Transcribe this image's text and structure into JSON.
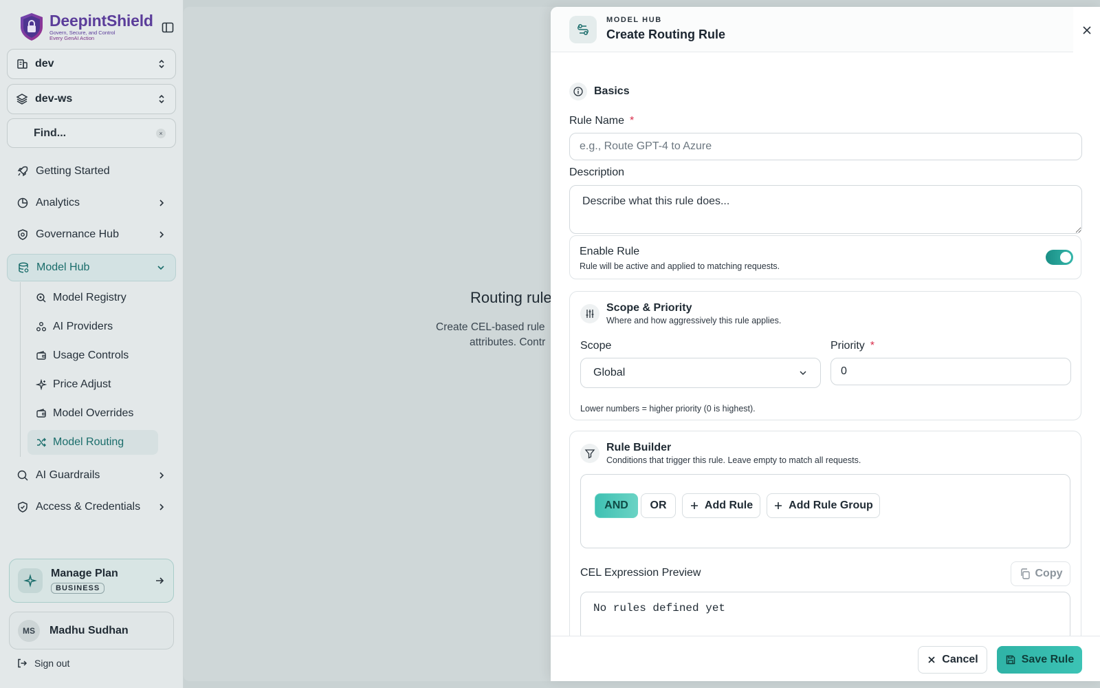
{
  "brand": {
    "name": "DeepintShield",
    "tagline_1": "Govern, Secure, and Control",
    "tagline_2": "Every GenAI Action"
  },
  "sidebar": {
    "org_selector": "dev",
    "workspace_selector": "dev-ws",
    "find_label": "Find...",
    "find_kbd": "×",
    "nav": [
      {
        "label": "Getting Started",
        "icon": "rocket-icon"
      },
      {
        "label": "Analytics",
        "icon": "chart-pie-icon"
      },
      {
        "label": "Governance Hub",
        "icon": "shield-cog-icon"
      },
      {
        "label": "Model Hub",
        "icon": "database-icon"
      },
      {
        "label": "AI Guardrails",
        "icon": "search-shield-icon"
      },
      {
        "label": "Access & Credentials",
        "icon": "shield-check-icon"
      }
    ],
    "model_hub_items": [
      {
        "label": "Model Registry",
        "icon": "search-icon"
      },
      {
        "label": "AI Providers",
        "icon": "network-icon"
      },
      {
        "label": "Usage Controls",
        "icon": "wallet-icon"
      },
      {
        "label": "Price Adjust",
        "icon": "sparkle-icon"
      },
      {
        "label": "Model Overrides",
        "icon": "wallet-icon"
      },
      {
        "label": "Model Routing",
        "icon": "shuffle-icon"
      }
    ],
    "plan": {
      "title": "Manage Plan",
      "badge": "BUSINESS"
    },
    "user": {
      "initials": "MS",
      "name": "Madhu Sudhan"
    },
    "sign_out": "Sign out"
  },
  "main": {
    "empty_title": "Routing rule",
    "empty_desc_1": "Create CEL-based rule",
    "empty_desc_2": "attributes. Contr"
  },
  "drawer": {
    "kicker": "MODEL HUB",
    "title": "Create Routing Rule",
    "basics_label": "Basics",
    "rule_name_label": "Rule Name",
    "required_mark": "*",
    "rule_name_placeholder": "e.g., Route GPT-4 to Azure",
    "description_label": "Description",
    "description_placeholder": "Describe what this rule does...",
    "enable": {
      "title": "Enable Rule",
      "subtitle": "Rule will be active and applied to matching requests.",
      "enabled": true
    },
    "scope_priority": {
      "title": "Scope & Priority",
      "subtitle": "Where and how aggressively this rule applies.",
      "scope_label": "Scope",
      "scope_value": "Global",
      "priority_label": "Priority",
      "priority_value": "0",
      "hint": "Lower numbers = higher priority (0 is highest)."
    },
    "rule_builder": {
      "title": "Rule Builder",
      "subtitle": "Conditions that trigger this rule. Leave empty to match all requests.",
      "and_label": "AND",
      "or_label": "OR",
      "add_rule_label": "Add Rule",
      "add_group_label": "Add Rule Group"
    },
    "cel": {
      "label": "CEL Expression Preview",
      "copy_label": "Copy",
      "preview": "No rules defined yet"
    },
    "footer": {
      "cancel_label": "Cancel",
      "save_label": "Save Rule"
    }
  },
  "colors": {
    "accent": "#2fb3a6",
    "brand": "#5b3d9a",
    "required": "#d92d4b"
  }
}
